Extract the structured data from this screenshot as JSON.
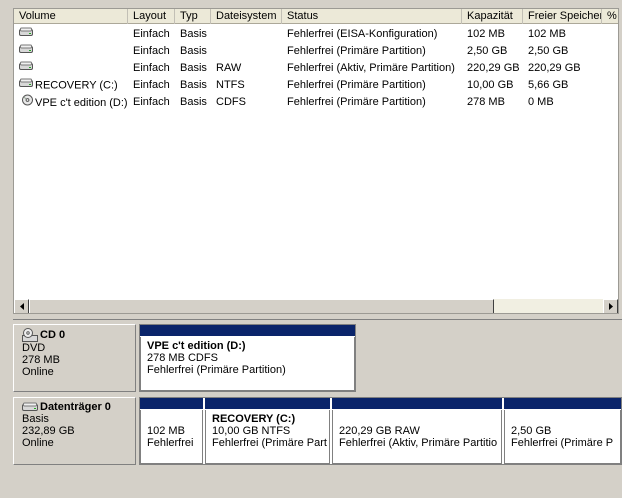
{
  "columns": [
    {
      "key": "vol",
      "label": "Volume"
    },
    {
      "key": "lay",
      "label": "Layout"
    },
    {
      "key": "typ",
      "label": "Typ"
    },
    {
      "key": "fs",
      "label": "Dateisystem"
    },
    {
      "key": "st",
      "label": "Status"
    },
    {
      "key": "kap",
      "label": "Kapazität"
    },
    {
      "key": "frei",
      "label": "Freier Speicher"
    },
    {
      "key": "more",
      "label": "%"
    }
  ],
  "volumes": [
    {
      "icon": "disk-volume-icon",
      "vol": "",
      "lay": "Einfach",
      "typ": "Basis",
      "fs": "",
      "st": "Fehlerfrei (EISA-Konfiguration)",
      "kap": "102 MB",
      "frei": "102 MB"
    },
    {
      "icon": "disk-volume-icon",
      "vol": "",
      "lay": "Einfach",
      "typ": "Basis",
      "fs": "",
      "st": "Fehlerfrei (Primäre Partition)",
      "kap": "2,50 GB",
      "frei": "2,50 GB"
    },
    {
      "icon": "disk-volume-icon",
      "vol": "",
      "lay": "Einfach",
      "typ": "Basis",
      "fs": "RAW",
      "st": "Fehlerfrei (Aktiv, Primäre Partition)",
      "kap": "220,29 GB",
      "frei": "220,29 GB"
    },
    {
      "icon": "disk-volume-icon",
      "vol": "RECOVERY (C:)",
      "lay": "Einfach",
      "typ": "Basis",
      "fs": "NTFS",
      "st": "Fehlerfrei (Primäre Partition)",
      "kap": "10,00 GB",
      "frei": "5,66 GB"
    },
    {
      "icon": "cd-volume-icon",
      "vol": "VPE c't edition (D:)",
      "lay": "Einfach",
      "typ": "Basis",
      "fs": "CDFS",
      "st": "Fehlerfrei (Primäre Partition)",
      "kap": "278 MB",
      "frei": "0 MB"
    }
  ],
  "cd0": {
    "name": "CD 0",
    "type": "DVD",
    "size": "278 MB",
    "state": "Online",
    "partition": {
      "name": "VPE c't edition  (D:)",
      "size": "278 MB CDFS",
      "status": "Fehlerfrei (Primäre Partition)"
    }
  },
  "disk0": {
    "name": "Datenträger 0",
    "type": "Basis",
    "size": "232,89 GB",
    "state": "Online",
    "partitions": [
      {
        "name": "",
        "size": "102 MB",
        "status": "Fehlerfrei"
      },
      {
        "name": "RECOVERY  (C:)",
        "size": "10,00 GB NTFS",
        "status": "Fehlerfrei (Primäre Part"
      },
      {
        "name": "",
        "size": "220,29 GB RAW",
        "status": "Fehlerfrei (Aktiv, Primäre Partitio"
      },
      {
        "name": "",
        "size": "2,50 GB",
        "status": "Fehlerfrei (Primäre P"
      }
    ]
  },
  "colors": {
    "partition_bar": "#0a246a",
    "background": "#d4d0c8"
  }
}
